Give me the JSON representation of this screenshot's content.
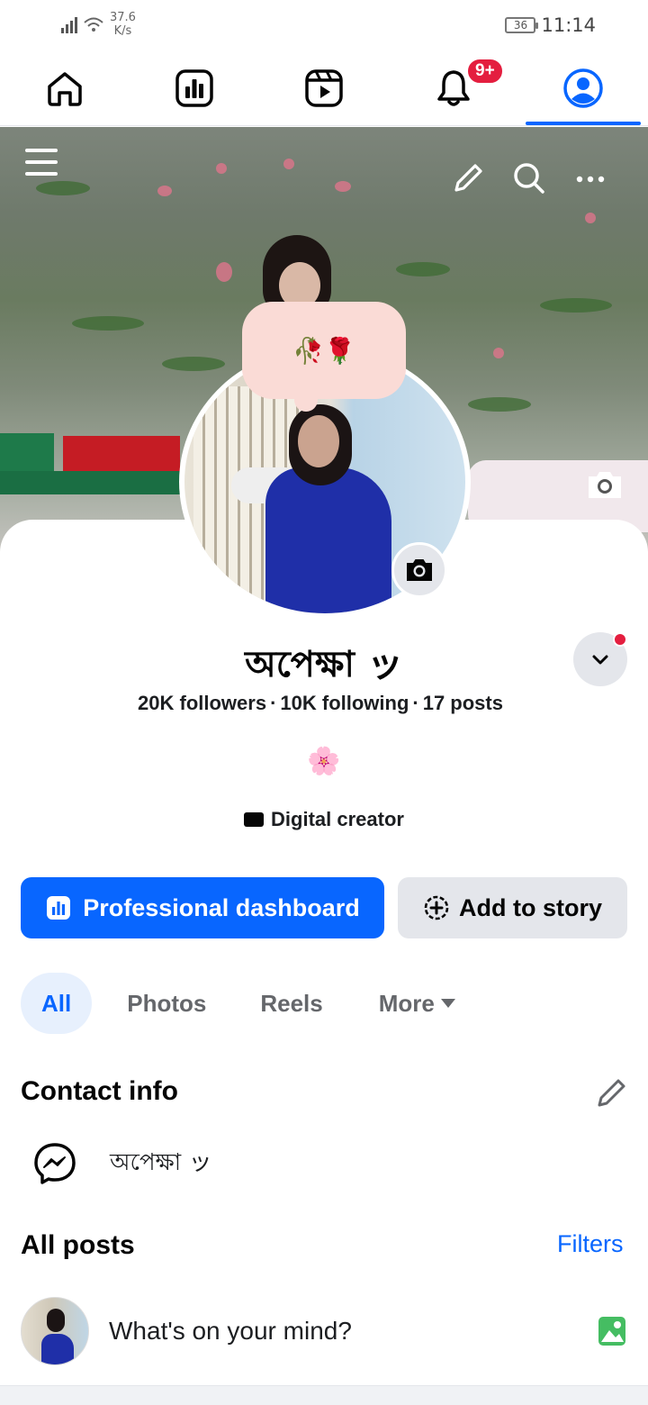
{
  "status_bar": {
    "network_speed_value": "37.6",
    "network_speed_unit": "K/s",
    "battery": "36",
    "time": "11:14"
  },
  "nav": {
    "tabs": [
      {
        "name": "home",
        "icon": "home-icon"
      },
      {
        "name": "dashboard",
        "icon": "bar-chart-icon"
      },
      {
        "name": "video",
        "icon": "reels-icon"
      },
      {
        "name": "notifications",
        "icon": "bell-icon",
        "badge": "9+"
      },
      {
        "name": "profile",
        "icon": "profile-icon",
        "active": true
      }
    ]
  },
  "cover": {
    "icons": [
      "menu-icon",
      "pencil-icon",
      "search-icon",
      "more-icon",
      "camera-icon"
    ]
  },
  "profile": {
    "note": "🥀🌹",
    "name": "অপেক্ষা ッ",
    "followers": "20K followers",
    "following": "10K following",
    "posts": "17 posts",
    "bio": "🌸",
    "category": "Digital creator"
  },
  "actions": {
    "primary_label": "Professional dashboard",
    "secondary_label": "Add to story"
  },
  "filter_tabs": [
    {
      "label": "All",
      "active": true
    },
    {
      "label": "Photos"
    },
    {
      "label": "Reels"
    },
    {
      "label": "More"
    }
  ],
  "contact": {
    "title": "Contact info",
    "messenger_name": "অপেক্ষা ッ"
  },
  "posts": {
    "title": "All posts",
    "filters_label": "Filters",
    "composer_placeholder": "What's on your mind?"
  },
  "colors": {
    "accent": "#0866ff",
    "badge": "#e41e3f",
    "photo_icon": "#45bd62"
  }
}
